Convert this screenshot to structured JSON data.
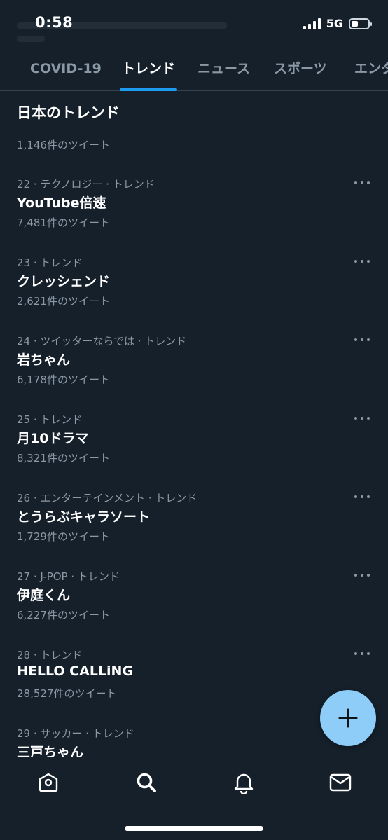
{
  "status_bar": {
    "time": "0:58",
    "network": "5G",
    "battery_level": 0.4,
    "signal_bars": 4
  },
  "tabs": [
    {
      "label": "COVID-19",
      "active": false
    },
    {
      "label": "トレンド",
      "active": true
    },
    {
      "label": "ニュース",
      "active": false
    },
    {
      "label": "スポーツ",
      "active": false
    },
    {
      "label": "エンタ",
      "active": false
    }
  ],
  "section_title": "日本のトレンド",
  "partial_count": "1,146件のツイート",
  "trends": [
    {
      "meta": "22 · テクノロジー · トレンド",
      "name": "YouTube倍速",
      "count": "7,481件のツイート"
    },
    {
      "meta": "23 · トレンド",
      "name": "クレッシェンド",
      "count": "2,621件のツイート"
    },
    {
      "meta": "24 · ツイッターならでは · トレンド",
      "name": "岩ちゃん",
      "count": "6,178件のツイート"
    },
    {
      "meta": "25 · トレンド",
      "name": "月10ドラマ",
      "count": "8,321件のツイート"
    },
    {
      "meta": "26 · エンターテインメント · トレンド",
      "name": "とうらぶキャラソート",
      "count": "1,729件のツイート"
    },
    {
      "meta": "27 · J-POP · トレンド",
      "name": "伊庭くん",
      "count": "6,227件のツイート"
    },
    {
      "meta": "28 · トレンド",
      "name": "HELLO CALLiNG",
      "count": "28,527件のツイート"
    },
    {
      "meta": "29 · サッカー · トレンド",
      "name": "三戸ちゃん",
      "count": ""
    }
  ],
  "icons": {
    "fab": "plus-icon",
    "nav": [
      "home-icon",
      "search-icon",
      "bell-icon",
      "mail-icon"
    ]
  },
  "colors": {
    "background": "#15202b",
    "accent": "#1d9bf0",
    "fab": "#8ecdf8",
    "secondary_text": "#8b98a5",
    "divider": "#38444d"
  }
}
